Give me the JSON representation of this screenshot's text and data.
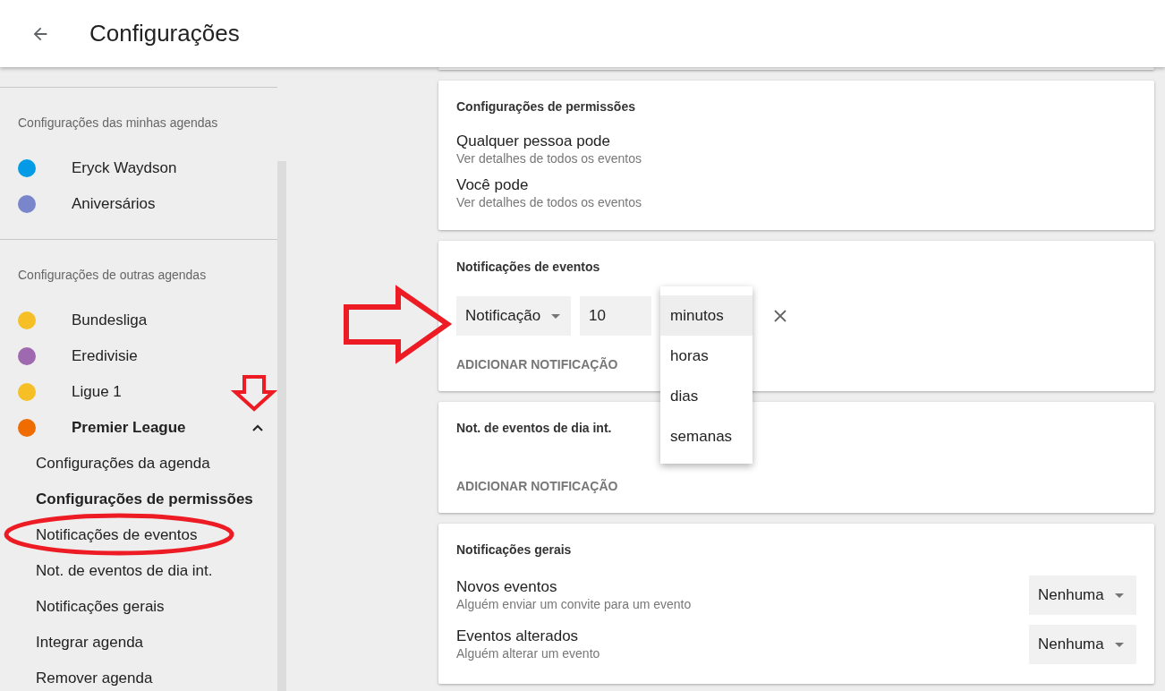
{
  "header": {
    "title": "Configurações"
  },
  "sidebar": {
    "sections": [
      {
        "heading": "Configurações das minhas agendas",
        "calendars": [
          {
            "name": "Eryck Waydson",
            "color": "#039be5",
            "selected": false,
            "expanded": false
          },
          {
            "name": "Aniversários",
            "color": "#7986cb",
            "selected": false,
            "expanded": false
          }
        ]
      },
      {
        "heading": "Configurações de outras agendas",
        "calendars": [
          {
            "name": "Bundesliga",
            "color": "#f6bf26",
            "selected": false,
            "expanded": false
          },
          {
            "name": "Eredivisie",
            "color": "#9e69af",
            "selected": false,
            "expanded": false
          },
          {
            "name": "Ligue 1",
            "color": "#f6bf26",
            "selected": false,
            "expanded": false
          },
          {
            "name": "Premier League",
            "color": "#ef6c00",
            "selected": true,
            "expanded": true,
            "children": [
              {
                "label": "Configurações da agenda",
                "selected": false
              },
              {
                "label": "Configurações de permissões",
                "selected": true
              },
              {
                "label": "Notificações de eventos",
                "selected": false
              },
              {
                "label": "Not. de eventos de dia int.",
                "selected": false
              },
              {
                "label": "Notificações gerais",
                "selected": false
              },
              {
                "label": "Integrar agenda",
                "selected": false
              },
              {
                "label": "Remover agenda",
                "selected": false
              }
            ]
          }
        ]
      }
    ]
  },
  "cards": [
    {
      "kind": "blank"
    },
    {
      "kind": "rows",
      "title": "Configurações de permissões",
      "rows": [
        {
          "label": "Qualquer pessoa pode",
          "detail": "Ver detalhes de todos os eventos"
        },
        {
          "label": "Você pode",
          "detail": "Ver detalhes de todos os eventos"
        }
      ]
    },
    {
      "kind": "notifications",
      "title": "Notificações de eventos",
      "notifications": [
        {
          "type": "Notificação",
          "amount": "10",
          "unit_menu": [
            {
              "label": "minutos",
              "selected": true
            },
            {
              "label": "horas",
              "selected": false
            },
            {
              "label": "dias",
              "selected": false
            },
            {
              "label": "semanas",
              "selected": false
            }
          ]
        }
      ],
      "add_label": "ADICIONAR NOTIFICAÇÃO"
    },
    {
      "kind": "notifications",
      "title": "Not. de eventos de dia int.",
      "add_label": "ADICIONAR NOTIFICAÇÃO"
    },
    {
      "kind": "rows",
      "title": "Notificações gerais",
      "rows": [
        {
          "label": "Novos eventos",
          "detail": "Alguém enviar um convite para um evento",
          "value": "Nenhuma"
        },
        {
          "label": "Eventos alterados",
          "detail": "Alguém alterar um evento",
          "value": "Nenhuma"
        }
      ]
    }
  ]
}
